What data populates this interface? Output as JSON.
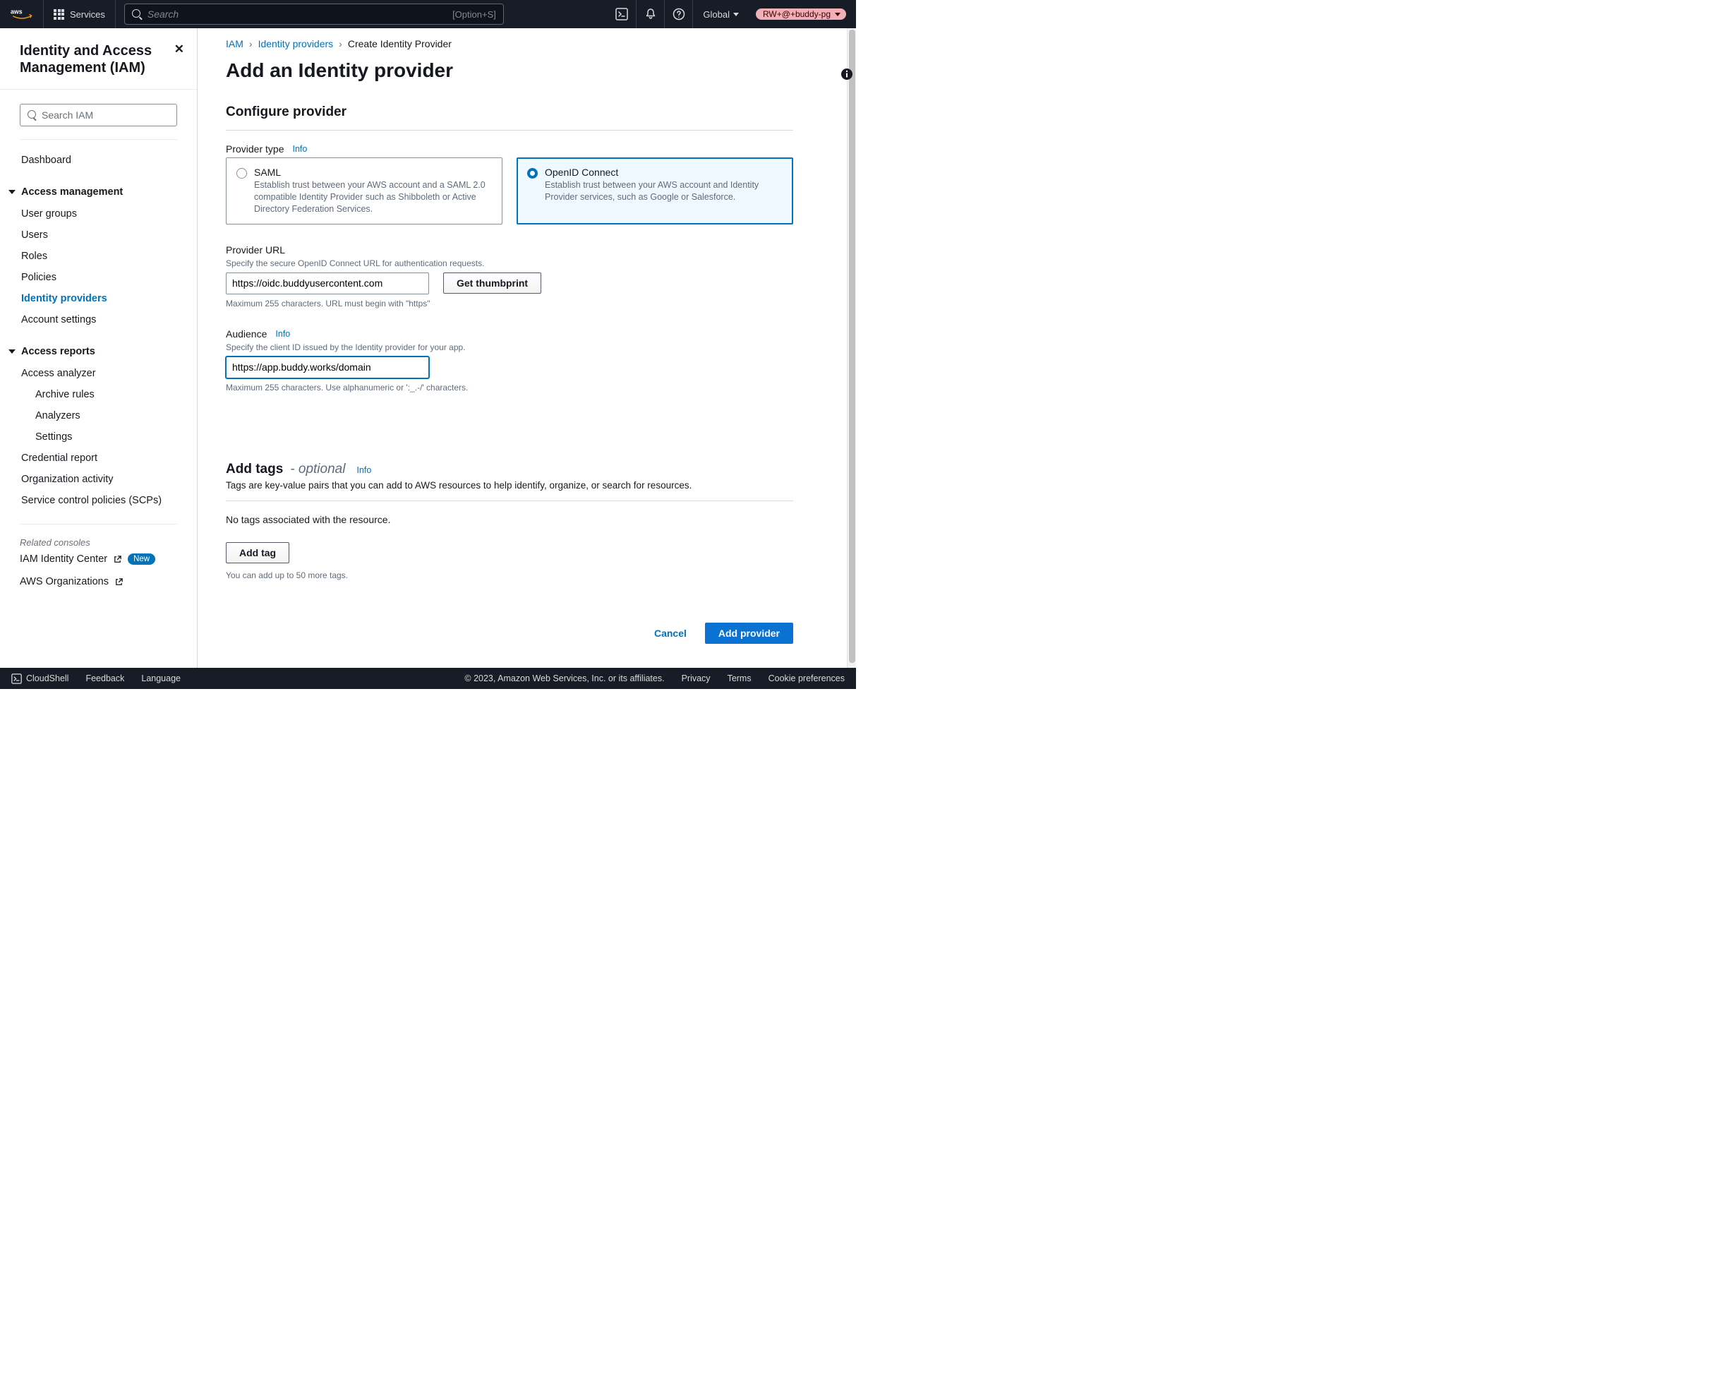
{
  "topnav": {
    "services": "Services",
    "search_placeholder": "Search",
    "search_shortcut": "[Option+S]",
    "global": "Global",
    "account": "RW+@+buddy-pg"
  },
  "sidebar": {
    "title": "Identity and Access Management (IAM)",
    "search_placeholder": "Search IAM",
    "dashboard": "Dashboard",
    "group_access": "Access management",
    "access_items": {
      "user_groups": "User groups",
      "users": "Users",
      "roles": "Roles",
      "policies": "Policies",
      "identity_providers": "Identity providers",
      "account_settings": "Account settings"
    },
    "group_reports": "Access reports",
    "reports_items": {
      "access_analyzer": "Access analyzer",
      "archive_rules": "Archive rules",
      "analyzers": "Analyzers",
      "settings": "Settings",
      "credential_report": "Credential report",
      "org_activity": "Organization activity",
      "scp": "Service control policies (SCPs)"
    },
    "related_heading": "Related consoles",
    "identity_center": "IAM Identity Center",
    "new_badge": "New",
    "orgs": "AWS Organizations"
  },
  "breadcrumbs": {
    "iam": "IAM",
    "idp": "Identity providers",
    "create": "Create Identity Provider"
  },
  "page": {
    "title": "Add an Identity provider",
    "configure_heading": "Configure provider",
    "provider_type_label": "Provider type",
    "info": "Info"
  },
  "tiles": {
    "saml": {
      "title": "SAML",
      "desc": "Establish trust between your AWS account and a SAML 2.0 compatible Identity Provider such as Shibboleth or Active Directory Federation Services."
    },
    "oidc": {
      "title": "OpenID Connect",
      "desc": "Establish trust between your AWS account and Identity Provider services, such as Google or Salesforce."
    }
  },
  "provider_url": {
    "label": "Provider URL",
    "help": "Specify the secure OpenID Connect URL for authentication requests.",
    "value": "https://oidc.buddyusercontent.com",
    "hint": "Maximum 255 characters. URL must begin with \"https\"",
    "button": "Get thumbprint"
  },
  "audience": {
    "label": "Audience",
    "help": "Specify the client ID issued by the Identity provider for your app.",
    "value": "https://app.buddy.works/domain",
    "hint": "Maximum 255 characters. Use alphanumeric or ':_.-/' characters."
  },
  "tags": {
    "heading": "Add tags",
    "optional": "- optional",
    "desc": "Tags are key-value pairs that you can add to AWS resources to help identify, organize, or search for resources.",
    "empty": "No tags associated with the resource.",
    "add_btn": "Add tag",
    "limit": "You can add up to 50 more tags."
  },
  "footer_actions": {
    "cancel": "Cancel",
    "add": "Add provider"
  },
  "bottombar": {
    "cloudshell": "CloudShell",
    "feedback": "Feedback",
    "language": "Language",
    "copyright": "© 2023, Amazon Web Services, Inc. or its affiliates.",
    "privacy": "Privacy",
    "terms": "Terms",
    "cookies": "Cookie preferences"
  }
}
